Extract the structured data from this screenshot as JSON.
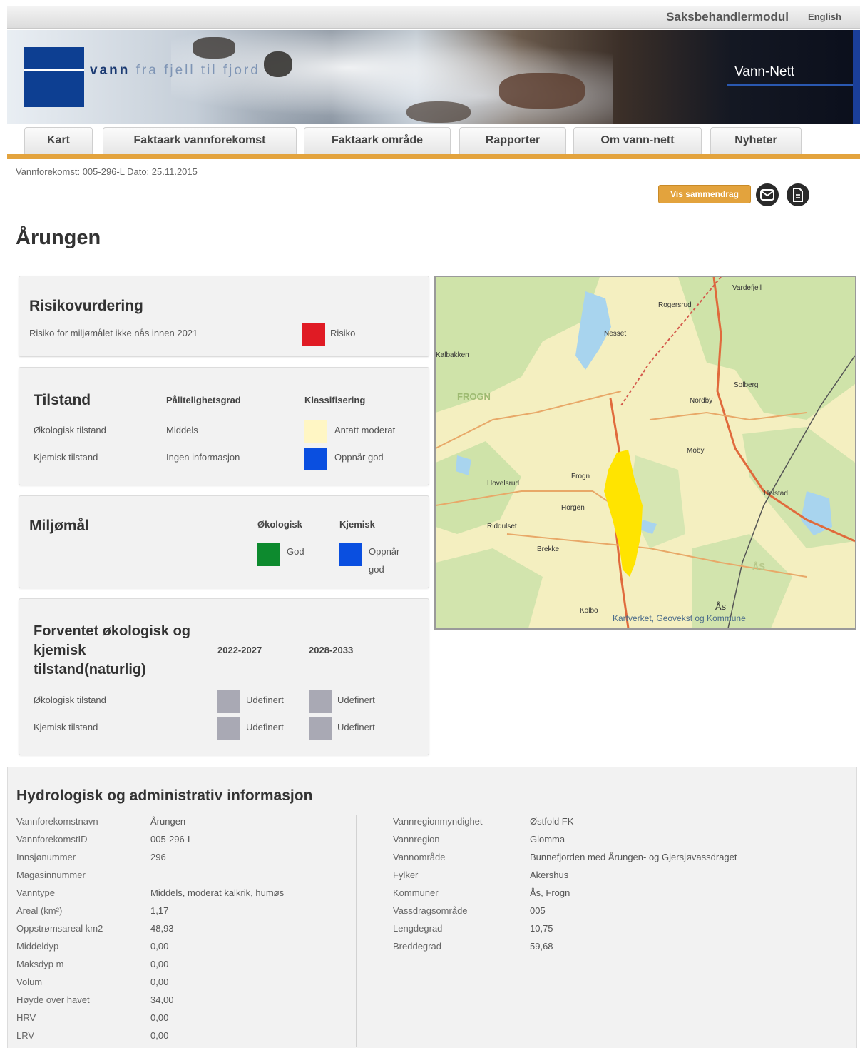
{
  "topbar": {
    "case_module": "Saksbehandlermodul",
    "language": "English"
  },
  "banner": {
    "tagline_bold": "vann",
    "tagline_rest": " fra fjell til fjord",
    "app_name": "Vann-Nett"
  },
  "nav": {
    "tabs": [
      "Kart",
      "Faktaark vannforekomst",
      "Faktaark område",
      "Rapporter",
      "Om vann-nett",
      "Nyheter"
    ]
  },
  "meta": {
    "line": "Vannforekomst: 005-296-L Dato: 25.11.2015"
  },
  "actions": {
    "summary_button": "Vis sammendrag",
    "email_icon": "envelope-icon",
    "doc_icon": "document-icon"
  },
  "page": {
    "title": "Årungen"
  },
  "risk": {
    "heading": "Risikovurdering",
    "text": "Risiko for miljømålet ikke nås innen 2021",
    "value": "Risiko",
    "color": "#e01b24"
  },
  "condition": {
    "heading": "Tilstand",
    "col_reliability": "Pålitelighetsgrad",
    "col_class": "Klassifisering",
    "rows": [
      {
        "label": "Økologisk tilstand",
        "reliability": "Middels",
        "class": "Antatt moderat",
        "color": "#fff6c4"
      },
      {
        "label": "Kjemisk tilstand",
        "reliability": "Ingen informasjon",
        "class": "Oppnår god",
        "color": "#0a4fe0"
      }
    ]
  },
  "goals": {
    "heading": "Miljømål",
    "col_eco": "Økologisk",
    "col_chem": "Kjemisk",
    "eco_value": "God",
    "eco_color": "#0d8a2e",
    "chem_value_line1": "Oppnår",
    "chem_value_line2": "god",
    "chem_color": "#0a4fe0"
  },
  "expected": {
    "heading_line1": "Forventet økologisk og",
    "heading_line2": "kjemisk",
    "heading_line3": "tilstand(naturlig)",
    "period1": "2022-2027",
    "period2": "2028-2033",
    "rows": [
      {
        "label": "Økologisk tilstand",
        "v1": "Udefinert",
        "v2": "Udefinert"
      },
      {
        "label": "Kjemisk tilstand",
        "v1": "Udefinert",
        "v2": "Udefinert"
      }
    ],
    "color": "#a9a9b4"
  },
  "map": {
    "labels": {
      "frogn_region": "FROGN",
      "kalbakken": "Kalbakken",
      "frogn": "Frogn",
      "hovelsrud": "Hovelsrud",
      "horgen": "Horgen",
      "riddulset": "Riddulset",
      "brekke": "Brekke",
      "nordby": "Nordby",
      "moby": "Moby",
      "holstad": "Holstad",
      "as": "Ås",
      "kolbo": "Kolbo",
      "solberg": "Solberg",
      "rogersrud": "Rogersrud",
      "nesset": "Nesset",
      "vardefjell": "Vardefjell",
      "as_region": "ÅS"
    },
    "attribution": "Kartverket, Geovekst og Kommune",
    "lake_color": "#ffe400"
  },
  "info": {
    "heading": "Hydrologisk og administrativ informasjon",
    "left": [
      {
        "label": "Vannforekomstnavn",
        "value": "Årungen"
      },
      {
        "label": "VannforekomstID",
        "value": "005-296-L"
      },
      {
        "label": "Innsjønummer",
        "value": "296"
      },
      {
        "label": "Magasinnummer",
        "value": ""
      },
      {
        "label": "Vanntype",
        "value": "Middels, moderat kalkrik, humøs"
      },
      {
        "label": "Areal (km²)",
        "value": "1,17"
      },
      {
        "label": "Oppstrømsareal km2",
        "value": "48,93"
      },
      {
        "label": "Middeldyp",
        "value": "0,00"
      },
      {
        "label": "Maksdyp m",
        "value": "0,00"
      },
      {
        "label": "Volum",
        "value": "0,00"
      },
      {
        "label": "Høyde over havet",
        "value": "34,00"
      },
      {
        "label": "HRV",
        "value": "0,00"
      },
      {
        "label": "LRV",
        "value": "0,00"
      }
    ],
    "right": [
      {
        "label": "Vannregionmyndighet",
        "value": "Østfold FK"
      },
      {
        "label": "Vannregion",
        "value": "Glomma"
      },
      {
        "label": "Vannområde",
        "value": "Bunnefjorden med Årungen- og Gjersjøvassdraget"
      },
      {
        "label": "Fylker",
        "value": "Akershus"
      },
      {
        "label": "Kommuner",
        "value": "Ås, Frogn"
      },
      {
        "label": "Vassdragsområde",
        "value": "005"
      },
      {
        "label": "Lengdegrad",
        "value": "10,75"
      },
      {
        "label": "Breddegrad",
        "value": "59,68"
      }
    ]
  }
}
